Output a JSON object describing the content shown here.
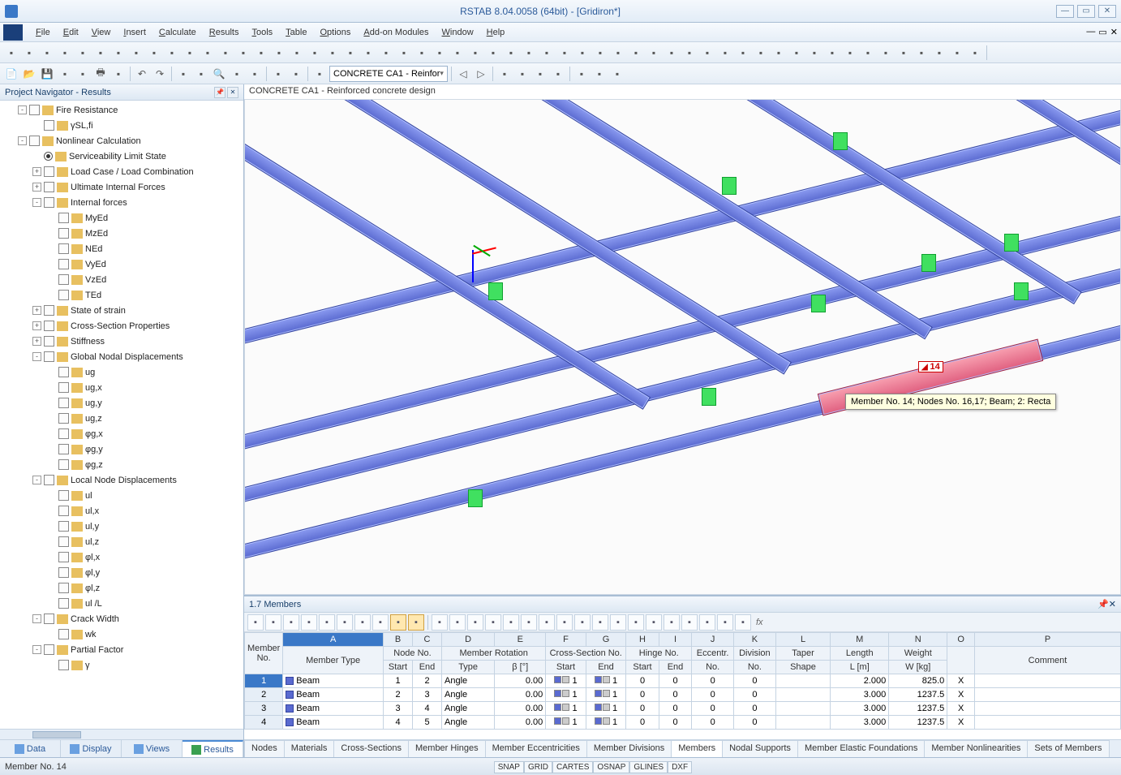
{
  "title": "RSTAB 8.04.0058 (64bit) - [Gridiron*]",
  "menu": [
    "File",
    "Edit",
    "View",
    "Insert",
    "Calculate",
    "Results",
    "Tools",
    "Table",
    "Options",
    "Add-on Modules",
    "Window",
    "Help"
  ],
  "toolbar2_combo": "CONCRETE CA1 - Reinfor",
  "navigator": {
    "title": "Project Navigator - Results",
    "tabs": [
      "Data",
      "Display",
      "Views",
      "Results"
    ],
    "active_tab": 3,
    "items": [
      {
        "d": 1,
        "exp": "-",
        "cb": true,
        "label": "Fire Resistance"
      },
      {
        "d": 2,
        "exp": "",
        "cb": true,
        "label": "γSL,fi"
      },
      {
        "d": 1,
        "exp": "-",
        "cb": true,
        "label": "Nonlinear Calculation"
      },
      {
        "d": 2,
        "exp": "",
        "radio": true,
        "label": "Serviceability Limit State"
      },
      {
        "d": 2,
        "exp": "+",
        "cb": true,
        "label": "Load Case / Load Combination"
      },
      {
        "d": 2,
        "exp": "+",
        "cb": true,
        "label": "Ultimate Internal Forces"
      },
      {
        "d": 2,
        "exp": "-",
        "cb": true,
        "label": "Internal forces"
      },
      {
        "d": 3,
        "exp": "",
        "cb": true,
        "label": "MyEd"
      },
      {
        "d": 3,
        "exp": "",
        "cb": true,
        "label": "MzEd"
      },
      {
        "d": 3,
        "exp": "",
        "cb": true,
        "label": "NEd"
      },
      {
        "d": 3,
        "exp": "",
        "cb": true,
        "label": "VyEd"
      },
      {
        "d": 3,
        "exp": "",
        "cb": true,
        "label": "VzEd"
      },
      {
        "d": 3,
        "exp": "",
        "cb": true,
        "label": "TEd"
      },
      {
        "d": 2,
        "exp": "+",
        "cb": true,
        "label": "State of strain"
      },
      {
        "d": 2,
        "exp": "+",
        "cb": true,
        "label": "Cross-Section Properties"
      },
      {
        "d": 2,
        "exp": "+",
        "cb": true,
        "label": "Stiffness"
      },
      {
        "d": 2,
        "exp": "-",
        "cb": true,
        "label": "Global Nodal Displacements"
      },
      {
        "d": 3,
        "exp": "",
        "cb": true,
        "label": "ug"
      },
      {
        "d": 3,
        "exp": "",
        "cb": true,
        "label": "ug,x"
      },
      {
        "d": 3,
        "exp": "",
        "cb": true,
        "label": "ug,y"
      },
      {
        "d": 3,
        "exp": "",
        "cb": true,
        "label": "ug,z"
      },
      {
        "d": 3,
        "exp": "",
        "cb": true,
        "label": "φg,x"
      },
      {
        "d": 3,
        "exp": "",
        "cb": true,
        "label": "φg,y"
      },
      {
        "d": 3,
        "exp": "",
        "cb": true,
        "label": "φg,z"
      },
      {
        "d": 2,
        "exp": "-",
        "cb": true,
        "label": "Local Node Displacements"
      },
      {
        "d": 3,
        "exp": "",
        "cb": true,
        "label": "ul"
      },
      {
        "d": 3,
        "exp": "",
        "cb": true,
        "label": "ul,x"
      },
      {
        "d": 3,
        "exp": "",
        "cb": true,
        "label": "ul,y"
      },
      {
        "d": 3,
        "exp": "",
        "cb": true,
        "label": "ul,z"
      },
      {
        "d": 3,
        "exp": "",
        "cb": true,
        "label": "φl,x"
      },
      {
        "d": 3,
        "exp": "",
        "cb": true,
        "label": "φl,y"
      },
      {
        "d": 3,
        "exp": "",
        "cb": true,
        "label": "φl,z"
      },
      {
        "d": 3,
        "exp": "",
        "cb": true,
        "label": "ul /L"
      },
      {
        "d": 2,
        "exp": "-",
        "cb": true,
        "label": "Crack Width"
      },
      {
        "d": 3,
        "exp": "",
        "cb": true,
        "label": "wk"
      },
      {
        "d": 2,
        "exp": "-",
        "cb": true,
        "label": "Partial Factor"
      },
      {
        "d": 3,
        "exp": "",
        "cb": true,
        "label": "γ"
      }
    ]
  },
  "viewport": {
    "label": "CONCRETE CA1 - Reinforced concrete design",
    "tooltip": "Member No. 14; Nodes No. 16,17; Beam; 2: Recta",
    "selected_marker": "14"
  },
  "members_panel": {
    "title": "1.7 Members",
    "col_letters": [
      "A",
      "B",
      "C",
      "D",
      "E",
      "F",
      "G",
      "H",
      "I",
      "J",
      "K",
      "L",
      "M",
      "N",
      "O",
      "P"
    ],
    "header_groups": [
      "Member No.",
      "Member Type",
      "Node No.",
      "Member Rotation",
      "Cross-Section No.",
      "Hinge No.",
      "Eccentr. No.",
      "Division No.",
      "Taper Shape",
      "Length L [m]",
      "Weight W [kg]",
      "",
      "Comment"
    ],
    "sub_headers": [
      "",
      "",
      "Start",
      "End",
      "Type",
      "β [°]",
      "Start",
      "End",
      "Start",
      "End",
      "",
      "",
      "",
      "",
      "",
      "",
      ""
    ],
    "rows": [
      {
        "n": 1,
        "type": "Beam",
        "s": 1,
        "e": 2,
        "rt": "Angle",
        "rb": "0.00",
        "cs": 1,
        "ce": 1,
        "hs": 0,
        "he": 0,
        "ec": 0,
        "dv": 0,
        "len": "2.000",
        "wgt": "825.0",
        "x": "X",
        "cmt": ""
      },
      {
        "n": 2,
        "type": "Beam",
        "s": 2,
        "e": 3,
        "rt": "Angle",
        "rb": "0.00",
        "cs": 1,
        "ce": 1,
        "hs": 0,
        "he": 0,
        "ec": 0,
        "dv": 0,
        "len": "3.000",
        "wgt": "1237.5",
        "x": "X",
        "cmt": ""
      },
      {
        "n": 3,
        "type": "Beam",
        "s": 3,
        "e": 4,
        "rt": "Angle",
        "rb": "0.00",
        "cs": 1,
        "ce": 1,
        "hs": 0,
        "he": 0,
        "ec": 0,
        "dv": 0,
        "len": "3.000",
        "wgt": "1237.5",
        "x": "X",
        "cmt": ""
      },
      {
        "n": 4,
        "type": "Beam",
        "s": 4,
        "e": 5,
        "rt": "Angle",
        "rb": "0.00",
        "cs": 1,
        "ce": 1,
        "hs": 0,
        "he": 0,
        "ec": 0,
        "dv": 0,
        "len": "3.000",
        "wgt": "1237.5",
        "x": "X",
        "cmt": ""
      }
    ],
    "tabs": [
      "Nodes",
      "Materials",
      "Cross-Sections",
      "Member Hinges",
      "Member Eccentricities",
      "Member Divisions",
      "Members",
      "Nodal Supports",
      "Member Elastic Foundations",
      "Member Nonlinearities",
      "Sets of Members"
    ],
    "active_tab": 6
  },
  "statusbar": {
    "left": "Member No. 14",
    "boxes": [
      "SNAP",
      "GRID",
      "CARTES",
      "OSNAP",
      "GLINES",
      "DXF"
    ]
  }
}
